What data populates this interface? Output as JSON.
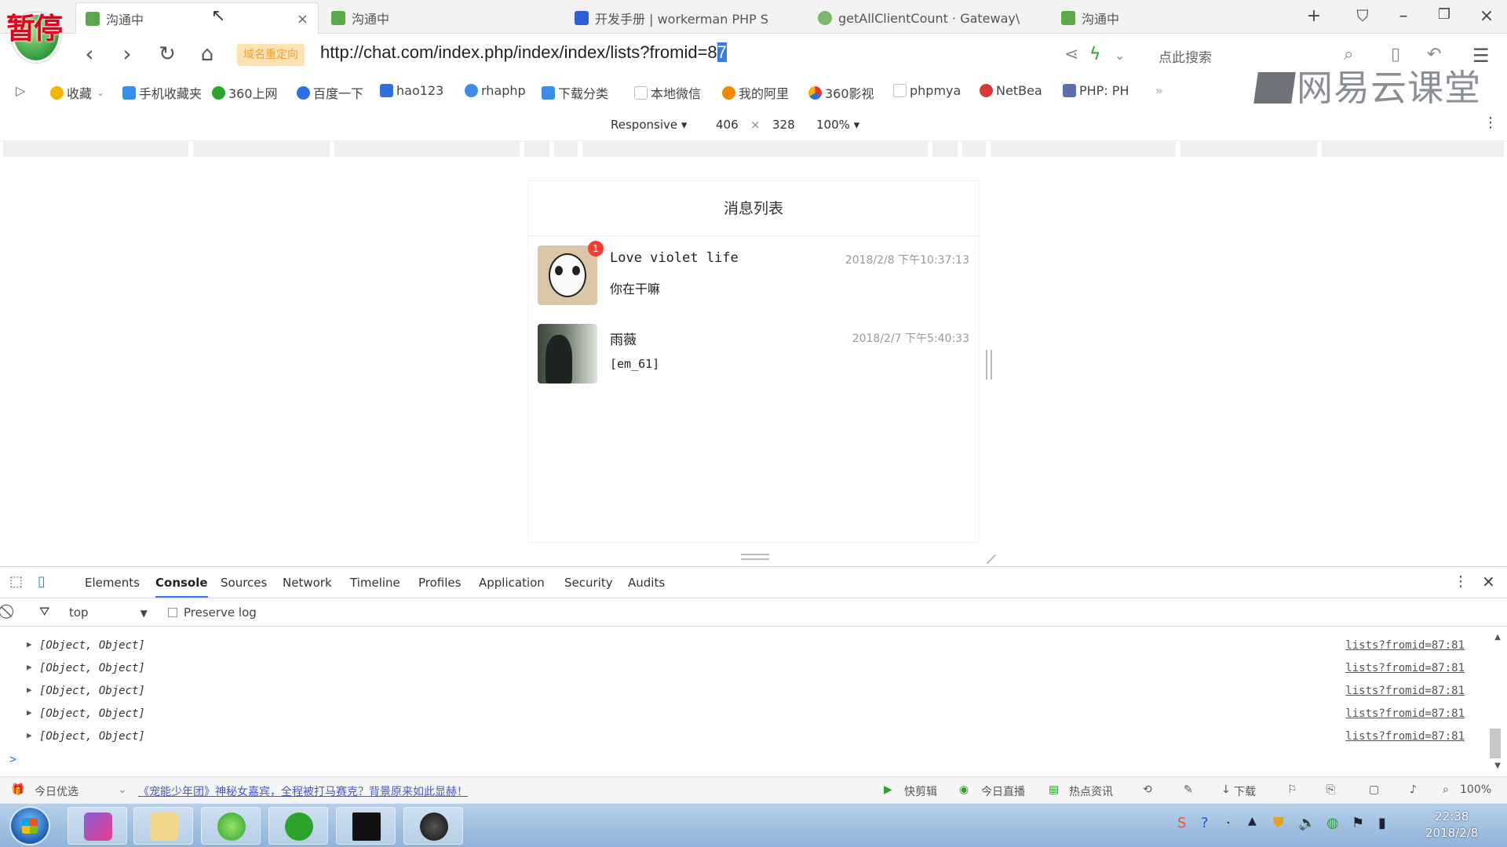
{
  "tabs": [
    {
      "title": "沟通中",
      "active": true
    },
    {
      "title": "沟通中",
      "active": false
    },
    {
      "title": "开发手册 | workerman PHP S",
      "active": false
    },
    {
      "title": "getAllClientCount · Gateway\\",
      "active": false
    },
    {
      "title": "沟通中",
      "active": false
    }
  ],
  "logo_overlay": "暂停",
  "address": {
    "redirect_badge": "域名重定向",
    "url_main": "http://chat.com/index.php/index/index/lists?fromid=8",
    "url_selected": "7",
    "search_hint": "点此搜索"
  },
  "bookmarks": [
    {
      "label": "收藏",
      "color": "#f5b400"
    },
    {
      "label": "手机收藏夹",
      "color": "#3a8ee6"
    },
    {
      "label": "360上网",
      "color": "#2aa52a"
    },
    {
      "label": "百度一下",
      "color": "#2d6fe0"
    },
    {
      "label": "hao123",
      "color": "#2d6fe0"
    },
    {
      "label": "rhaphp",
      "color": "#3a8ee6"
    },
    {
      "label": "下载分类",
      "color": "#3a8ee6"
    },
    {
      "label": "本地微信",
      "color": "#bbbbbb"
    },
    {
      "label": "我的阿里",
      "color": "#f08a00"
    },
    {
      "label": "360影视",
      "color": "#2d6fe0"
    },
    {
      "label": "phpmya",
      "color": "#bbbbbb"
    },
    {
      "label": "NetBea",
      "color": "#d93838"
    },
    {
      "label": "PHP: PH",
      "color": "#5b6fb0"
    }
  ],
  "watermark": "网易云课堂",
  "device_toolbar": {
    "mode": "Responsive",
    "width": "406",
    "times": "×",
    "height": "328",
    "zoom": "100%"
  },
  "viewport": {
    "title": "消息列表",
    "messages": [
      {
        "name": "Love violet life",
        "time": "2018/2/8 下午10:37:13",
        "text": "你在干嘛",
        "badge": "1",
        "avatar_color": "#d9c7a8"
      },
      {
        "name": "雨薇",
        "time": "2018/2/7 下午5:40:33",
        "text": "[em_61]",
        "badge": "",
        "avatar_color": "#6b7a6a"
      }
    ]
  },
  "devtools": {
    "tabs": [
      "Elements",
      "Console",
      "Sources",
      "Network",
      "Timeline",
      "Profiles",
      "Application",
      "Security",
      "Audits"
    ],
    "active_tab": "Console",
    "context": "top",
    "preserve_log": "Preserve log",
    "log_entries": [
      {
        "text": "[Object, Object]",
        "source": "lists?fromid=87:81"
      },
      {
        "text": "[Object, Object]",
        "source": "lists?fromid=87:81"
      },
      {
        "text": "[Object, Object]",
        "source": "lists?fromid=87:81"
      },
      {
        "text": "[Object, Object]",
        "source": "lists?fromid=87:81"
      },
      {
        "text": "[Object, Object]",
        "source": "lists?fromid=87:81"
      }
    ],
    "prompt": ">"
  },
  "statusbar": {
    "today_pick": "今日优选",
    "news": "《宠能少年团》神秘女嘉宾，全程被打马赛克？背景原来如此显赫！",
    "quick_cut": "快剪辑",
    "live": "今日直播",
    "hot": "热点资讯",
    "download": "下载",
    "zoom": "100%"
  },
  "taskbar": {
    "time": "22:38",
    "date": "2018/2/8"
  }
}
